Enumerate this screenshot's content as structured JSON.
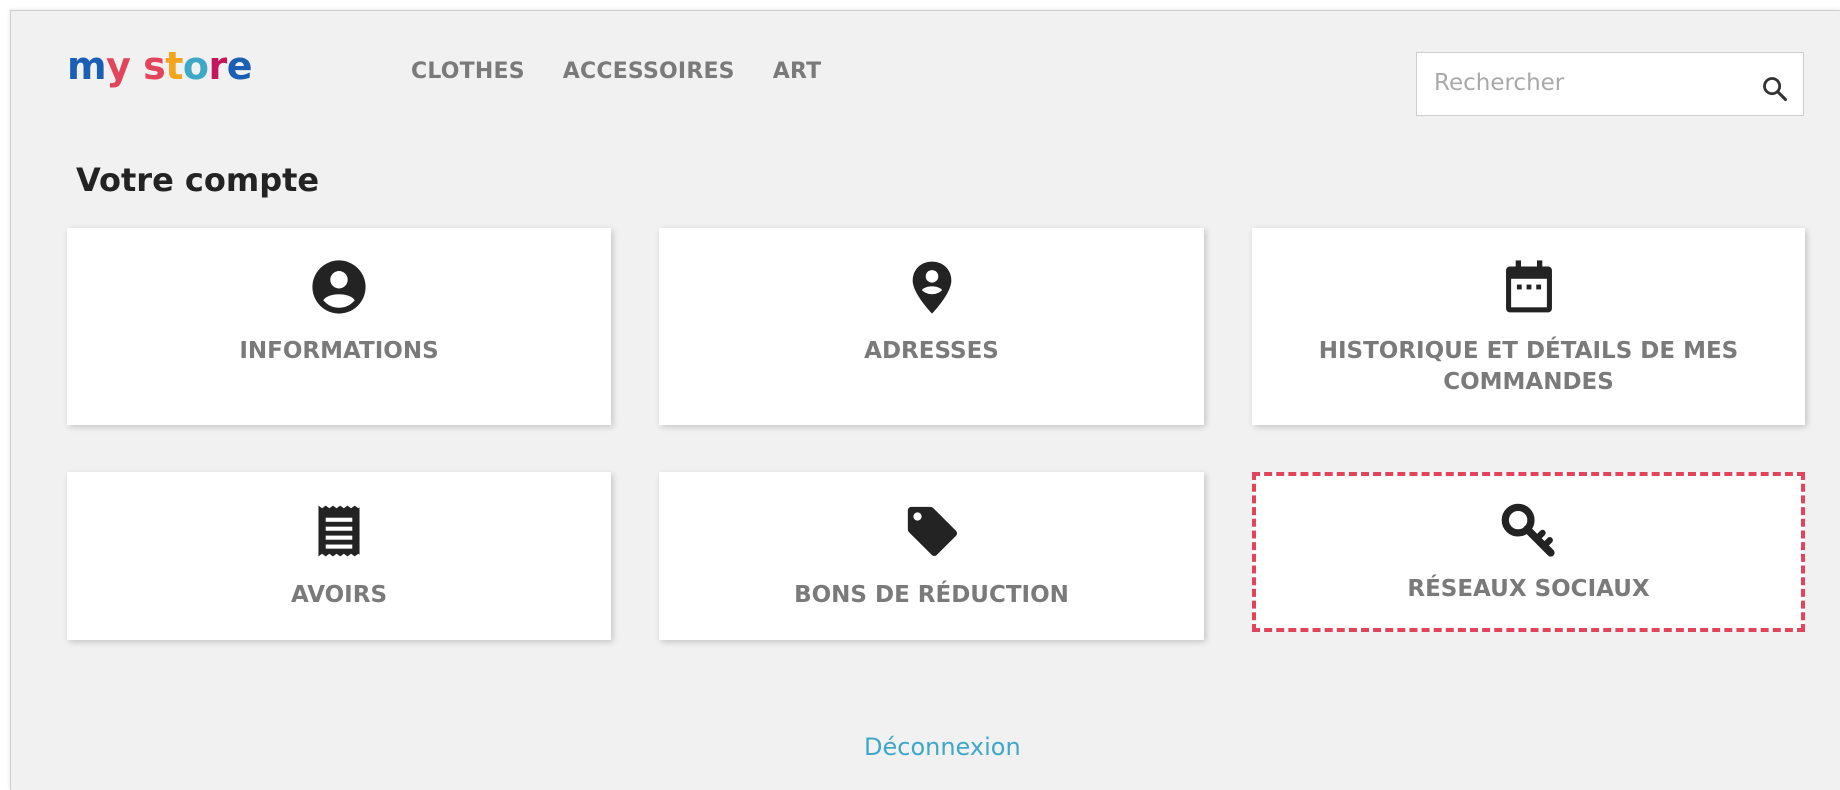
{
  "logo": {
    "parts": [
      "m",
      "y",
      " ",
      "s",
      "t",
      "o",
      "r",
      "e"
    ],
    "colors": [
      "#1a5fb4",
      "#e2445c",
      "#ffffff",
      "#e2445c",
      "#f2a51d",
      "#3fa8c7",
      "#c2185b",
      "#1a5fb4"
    ]
  },
  "nav": {
    "items": [
      "CLOTHES",
      "ACCESSOIRES",
      "ART"
    ]
  },
  "search": {
    "placeholder": "Rechercher"
  },
  "page_title": "Votre compte",
  "cards": [
    {
      "label": "INFORMATIONS",
      "icon": "account-circle-icon"
    },
    {
      "label": "ADRESSES",
      "icon": "location-pin-icon"
    },
    {
      "label": "HISTORIQUE ET DÉTAILS DE MES COMMANDES",
      "icon": "calendar-icon"
    },
    {
      "label": "AVOIRS",
      "icon": "receipt-icon"
    },
    {
      "label": "BONS DE RÉDUCTION",
      "icon": "tag-icon"
    },
    {
      "label": "RÉSEAUX SOCIAUX",
      "icon": "key-icon"
    }
  ],
  "logout": "Déconnexion",
  "colors": {
    "accent": "#3fa8c7",
    "highlight": "#e2445c",
    "text": "#7a7a7a",
    "icon": "#232323"
  }
}
